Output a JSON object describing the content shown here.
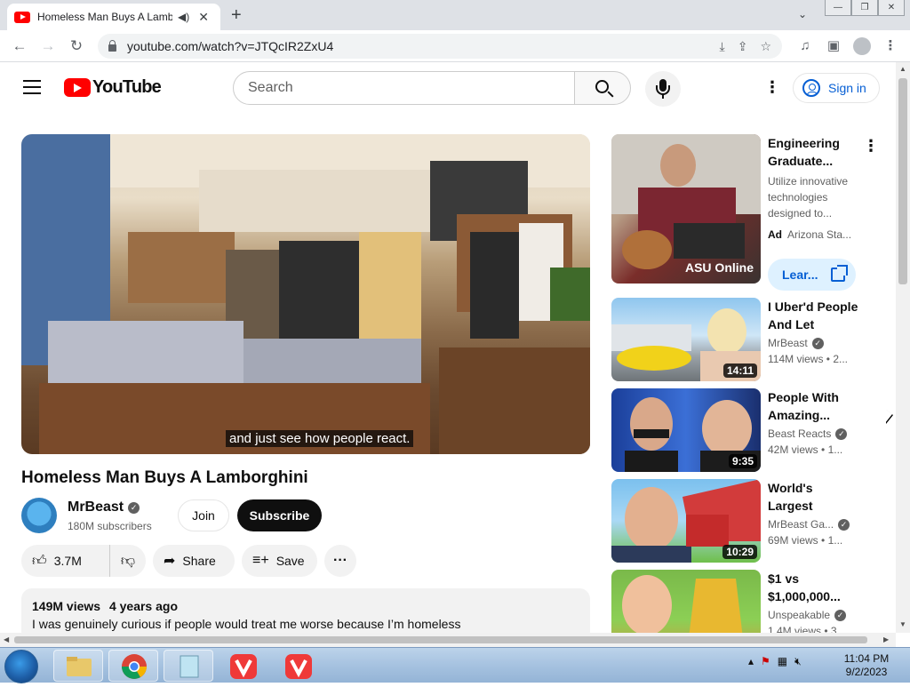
{
  "browser": {
    "tab_title": "Homeless Man Buys A Lamb",
    "url": "youtube.com/watch?v=JTQcIR2ZxU4"
  },
  "header": {
    "logo_text": "YouTube",
    "search_placeholder": "Search",
    "signin_label": "Sign in"
  },
  "player": {
    "subtitle": "and just see how people react."
  },
  "video": {
    "title": "Homeless Man Buys A Lamborghini",
    "channel": "MrBeast",
    "subscribers": "180M subscribers",
    "join_label": "Join",
    "subscribe_label": "Subscribe",
    "likes": "3.7M",
    "share_label": "Share",
    "save_label": "Save",
    "views": "149M views",
    "age": "4 years ago",
    "description": "I was genuinely curious if people would treat me worse because I’m homeless"
  },
  "sidebar": {
    "ad": {
      "title": "Engineering Graduate...",
      "description": "Utilize innovative technologies designed to...",
      "ad_tag": "Ad",
      "advertiser": "Arizona Sta...",
      "cta": "Lear...",
      "thumb_text": "ASU Online"
    },
    "items": [
      {
        "title": "I Uber'd People And Let Them...",
        "channel": "MrBeast",
        "views": "114M views",
        "age": "2...",
        "duration": "14:11"
      },
      {
        "title": "People With Amazing...",
        "channel": "Beast Reacts",
        "views": "42M views",
        "age": "1...",
        "duration": "9:35"
      },
      {
        "title": "World's Largest Experiment!",
        "channel": "MrBeast Ga...",
        "views": "69M views",
        "age": "1...",
        "duration": "10:29"
      },
      {
        "title": "$1 vs $1,000,000...",
        "channel": "Unspeakable",
        "views": "1.4M views",
        "age": "3...",
        "duration": ""
      }
    ]
  },
  "taskbar": {
    "time": "11:04 PM",
    "date": "9/2/2023"
  },
  "colors": {
    "youtube_red": "#ff0000",
    "link_blue": "#065fd4",
    "subscribe_black": "#0f0f0f"
  }
}
